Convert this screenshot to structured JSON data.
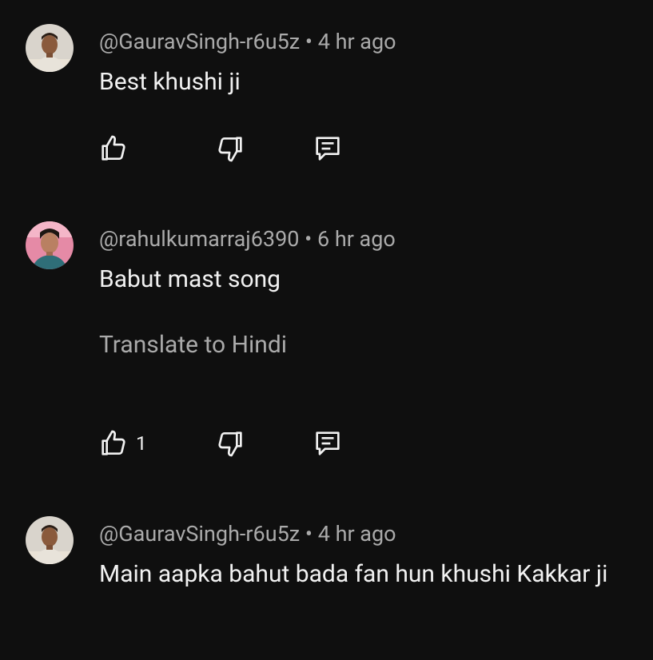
{
  "comments": [
    {
      "author": "@GauravSingh-r6u5z",
      "separator": "•",
      "time": "4 hr ago",
      "text": "Best khushi ji",
      "like_count": "",
      "translate_label": ""
    },
    {
      "author": "@rahulkumarraj6390",
      "separator": "•",
      "time": "6 hr ago",
      "text": "Babut mast song",
      "like_count": "1",
      "translate_label": "Translate to Hindi"
    },
    {
      "author": "@GauravSingh-r6u5z",
      "separator": "•",
      "time": "4 hr ago",
      "text": "Main aapka bahut bada fan hun khushi Kakkar ji",
      "like_count": "",
      "translate_label": ""
    }
  ],
  "icons": {
    "like": "thumb-up-icon",
    "dislike": "thumb-down-icon",
    "reply": "reply-comment-icon"
  },
  "colors": {
    "background": "#0f0f0f",
    "primary_text": "#f1f1f1",
    "secondary_text": "#aaaaaa"
  }
}
